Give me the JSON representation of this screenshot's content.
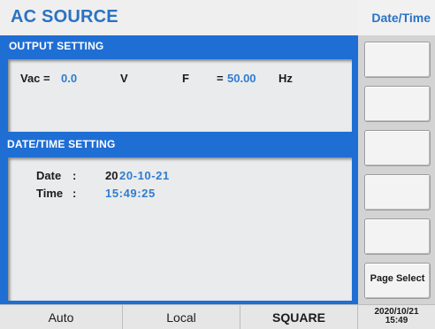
{
  "header": {
    "title": "AC SOURCE"
  },
  "output_setting": {
    "title": "OUTPUT SETTING",
    "vac_label": "Vac =",
    "vac_value": "0.0",
    "vac_unit": "V",
    "freq_label": "F",
    "freq_eq": "=",
    "freq_value": "50.00",
    "freq_unit": "Hz"
  },
  "datetime_setting": {
    "title": "DATE/TIME SETTING",
    "date_label": "Date",
    "date_colon": ":",
    "date_prefix": "20",
    "date_value": "20-10-21",
    "time_label": "Time",
    "time_colon": ":",
    "time_value": "15:49:25"
  },
  "sidebar": {
    "title": "Date/Time",
    "softkeys": [
      "",
      "",
      "",
      "",
      "",
      "Page Select"
    ]
  },
  "status_bar": {
    "mode": "Auto",
    "control": "Local",
    "waveform": "SQUARE",
    "clock_date": "2020/10/21",
    "clock_time": "15:49"
  }
}
